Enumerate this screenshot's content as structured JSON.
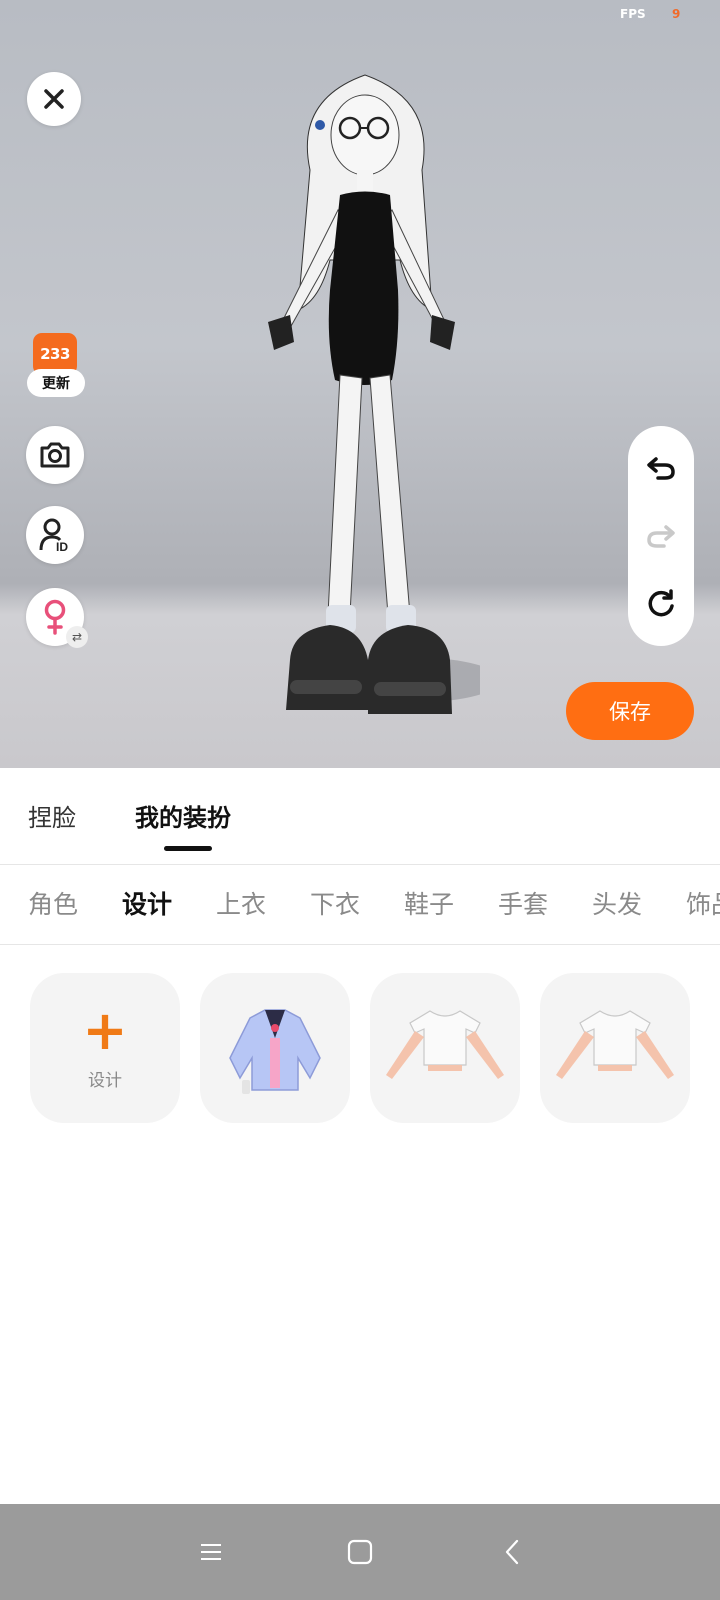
{
  "viewport": {
    "fps_label": "FPS",
    "fps_value": "9",
    "update_badge": {
      "logo_text": "233",
      "label": "更新"
    },
    "save_label": "保存"
  },
  "main_tabs": [
    {
      "label": "捏脸",
      "active": false
    },
    {
      "label": "我的装扮",
      "active": true
    }
  ],
  "category_tabs": [
    {
      "label": "角色",
      "active": false
    },
    {
      "label": "设计",
      "active": true
    },
    {
      "label": "上衣",
      "active": false
    },
    {
      "label": "下衣",
      "active": false
    },
    {
      "label": "鞋子",
      "active": false
    },
    {
      "label": "手套",
      "active": false
    },
    {
      "label": "头发",
      "active": false
    },
    {
      "label": "饰品",
      "active": false
    }
  ],
  "items": {
    "add_label": "设计"
  },
  "colors": {
    "accent": "#ff6e12",
    "fps_value": "#f06a2a",
    "gender_icon": "#e8507a"
  },
  "icons": [
    "close-icon",
    "camera-icon",
    "user-id-icon",
    "female-icon",
    "swap-icon",
    "undo-icon",
    "redo-icon",
    "reset-icon",
    "menu-icon",
    "home-icon",
    "back-icon"
  ]
}
